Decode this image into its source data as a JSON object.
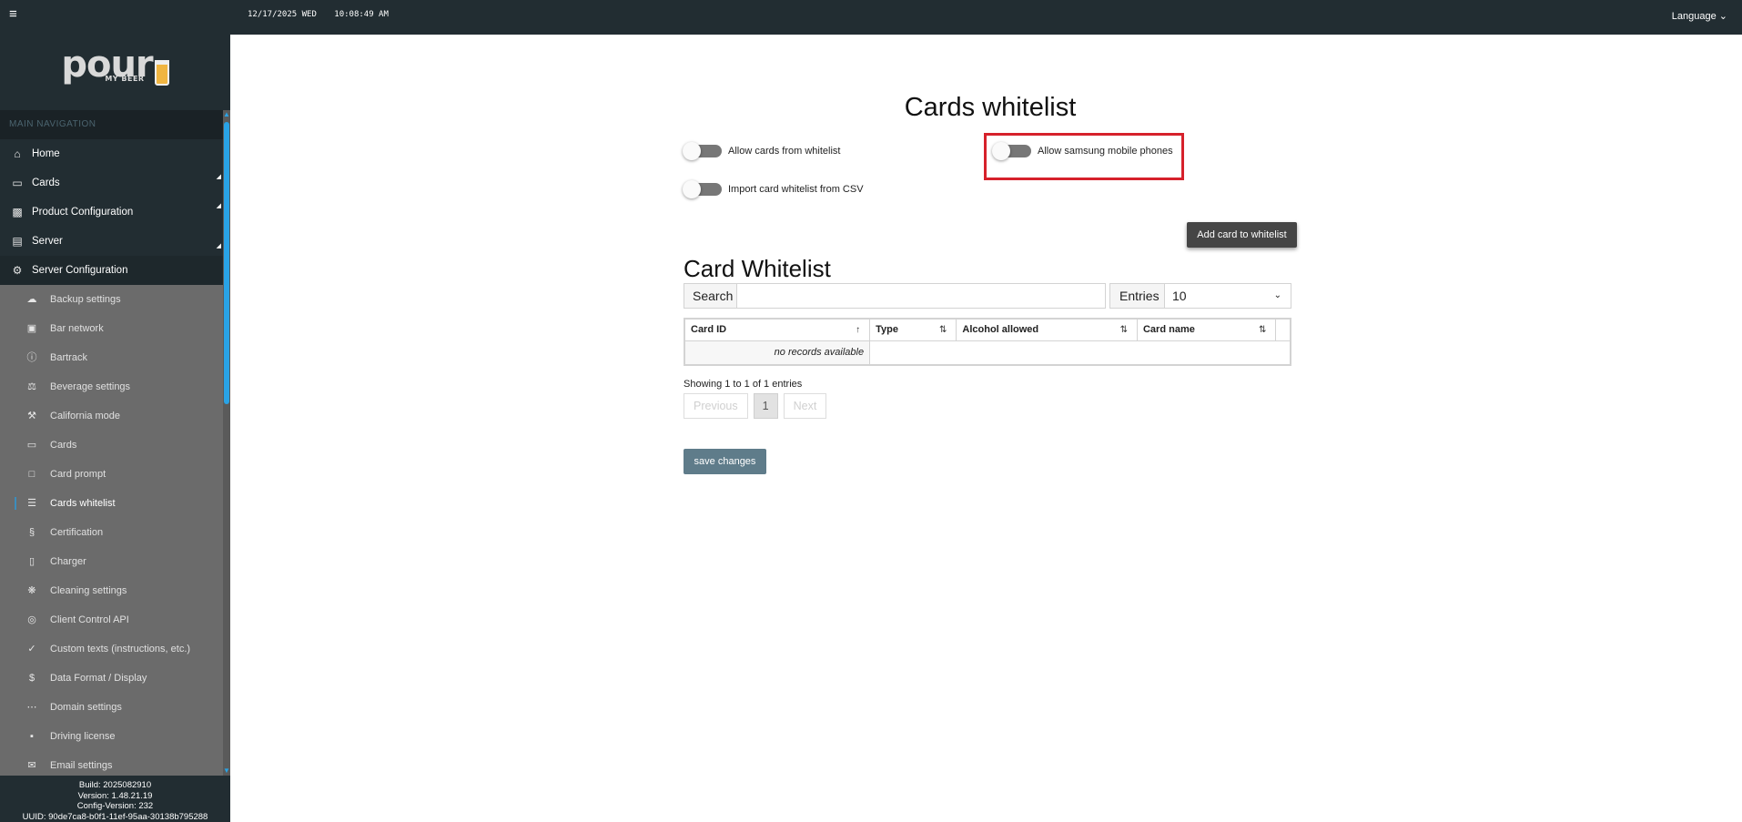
{
  "topbar": {
    "date": "12/17/2025 WED",
    "time": "10:08:49 AM",
    "language_label": "Language ⌄"
  },
  "brand": {
    "logo_main": "pour",
    "logo_sub_prefix": "MY ",
    "logo_sub_bold": "BEER"
  },
  "sidebar": {
    "header": "MAIN NAVIGATION",
    "items": [
      {
        "label": "Home",
        "icon": "home-icon"
      },
      {
        "label": "Cards",
        "icon": "card-icon"
      },
      {
        "label": "Product Configuration",
        "icon": "beer-icon"
      },
      {
        "label": "Server",
        "icon": "server-icon"
      },
      {
        "label": "Server Configuration",
        "icon": "gear-icon"
      }
    ],
    "sub_items": [
      {
        "label": "Backup settings",
        "icon": "cloud-icon"
      },
      {
        "label": "Bar network",
        "icon": "network-icon"
      },
      {
        "label": "Bartrack",
        "icon": "info-icon"
      },
      {
        "label": "Beverage settings",
        "icon": "scale-icon"
      },
      {
        "label": "California mode",
        "icon": "hammer-icon"
      },
      {
        "label": "Cards",
        "icon": "card-icon"
      },
      {
        "label": "Card prompt",
        "icon": "comment-icon"
      },
      {
        "label": "Cards whitelist",
        "icon": "list-icon"
      },
      {
        "label": "Certification",
        "icon": "section-icon"
      },
      {
        "label": "Charger",
        "icon": "tablet-icon"
      },
      {
        "label": "Cleaning settings",
        "icon": "spray-icon"
      },
      {
        "label": "Client Control API",
        "icon": "fingerprint-icon"
      },
      {
        "label": "Custom texts (instructions, etc.)",
        "icon": "check-icon"
      },
      {
        "label": "Data Format / Display",
        "icon": "dollar-icon"
      },
      {
        "label": "Domain settings",
        "icon": "dots-icon"
      },
      {
        "label": "Driving license",
        "icon": "id-card-icon"
      },
      {
        "label": "Email settings",
        "icon": "envelope-icon"
      }
    ],
    "footer": {
      "build": "Build: 2025082910",
      "version": "Version: 1.48.21.19",
      "config_version": "Config-Version: 232",
      "uuid": "UUID: 90de7ca8-b0f1-11ef-95aa-30138b795288"
    }
  },
  "main": {
    "page_title": "Cards whitelist",
    "toggles": {
      "allow_whitelist": {
        "label": "Allow cards from whitelist",
        "on": false
      },
      "allow_samsung": {
        "label": "Allow samsung mobile phones",
        "on": false
      },
      "import_csv": {
        "label": "Import card whitelist from CSV",
        "on": false
      }
    },
    "add_button": "Add card to whitelist",
    "section_title": "Card Whitelist",
    "search": {
      "label": "Search",
      "value": "",
      "placeholder": ""
    },
    "entries": {
      "label": "Entries",
      "value": "10"
    },
    "table": {
      "columns": [
        {
          "label": "Card ID",
          "sort": "↑"
        },
        {
          "label": "Type",
          "sort": "⇅"
        },
        {
          "label": "Alcohol allowed",
          "sort": "⇅"
        },
        {
          "label": "Card name",
          "sort": "⇅"
        }
      ],
      "empty_text": "no records available"
    },
    "showing": "Showing 1 to 1 of 1 entries",
    "pagination": {
      "previous": "Previous",
      "current": "1",
      "next": "Next"
    },
    "save_button": "save changes"
  },
  "colors": {
    "sidebar_bg": "#222d32",
    "submenu_bg": "#6b6b6b",
    "scroll_accent": "#29a3e6",
    "highlight": "#d6212b",
    "save_button": "#5f7c8a"
  }
}
